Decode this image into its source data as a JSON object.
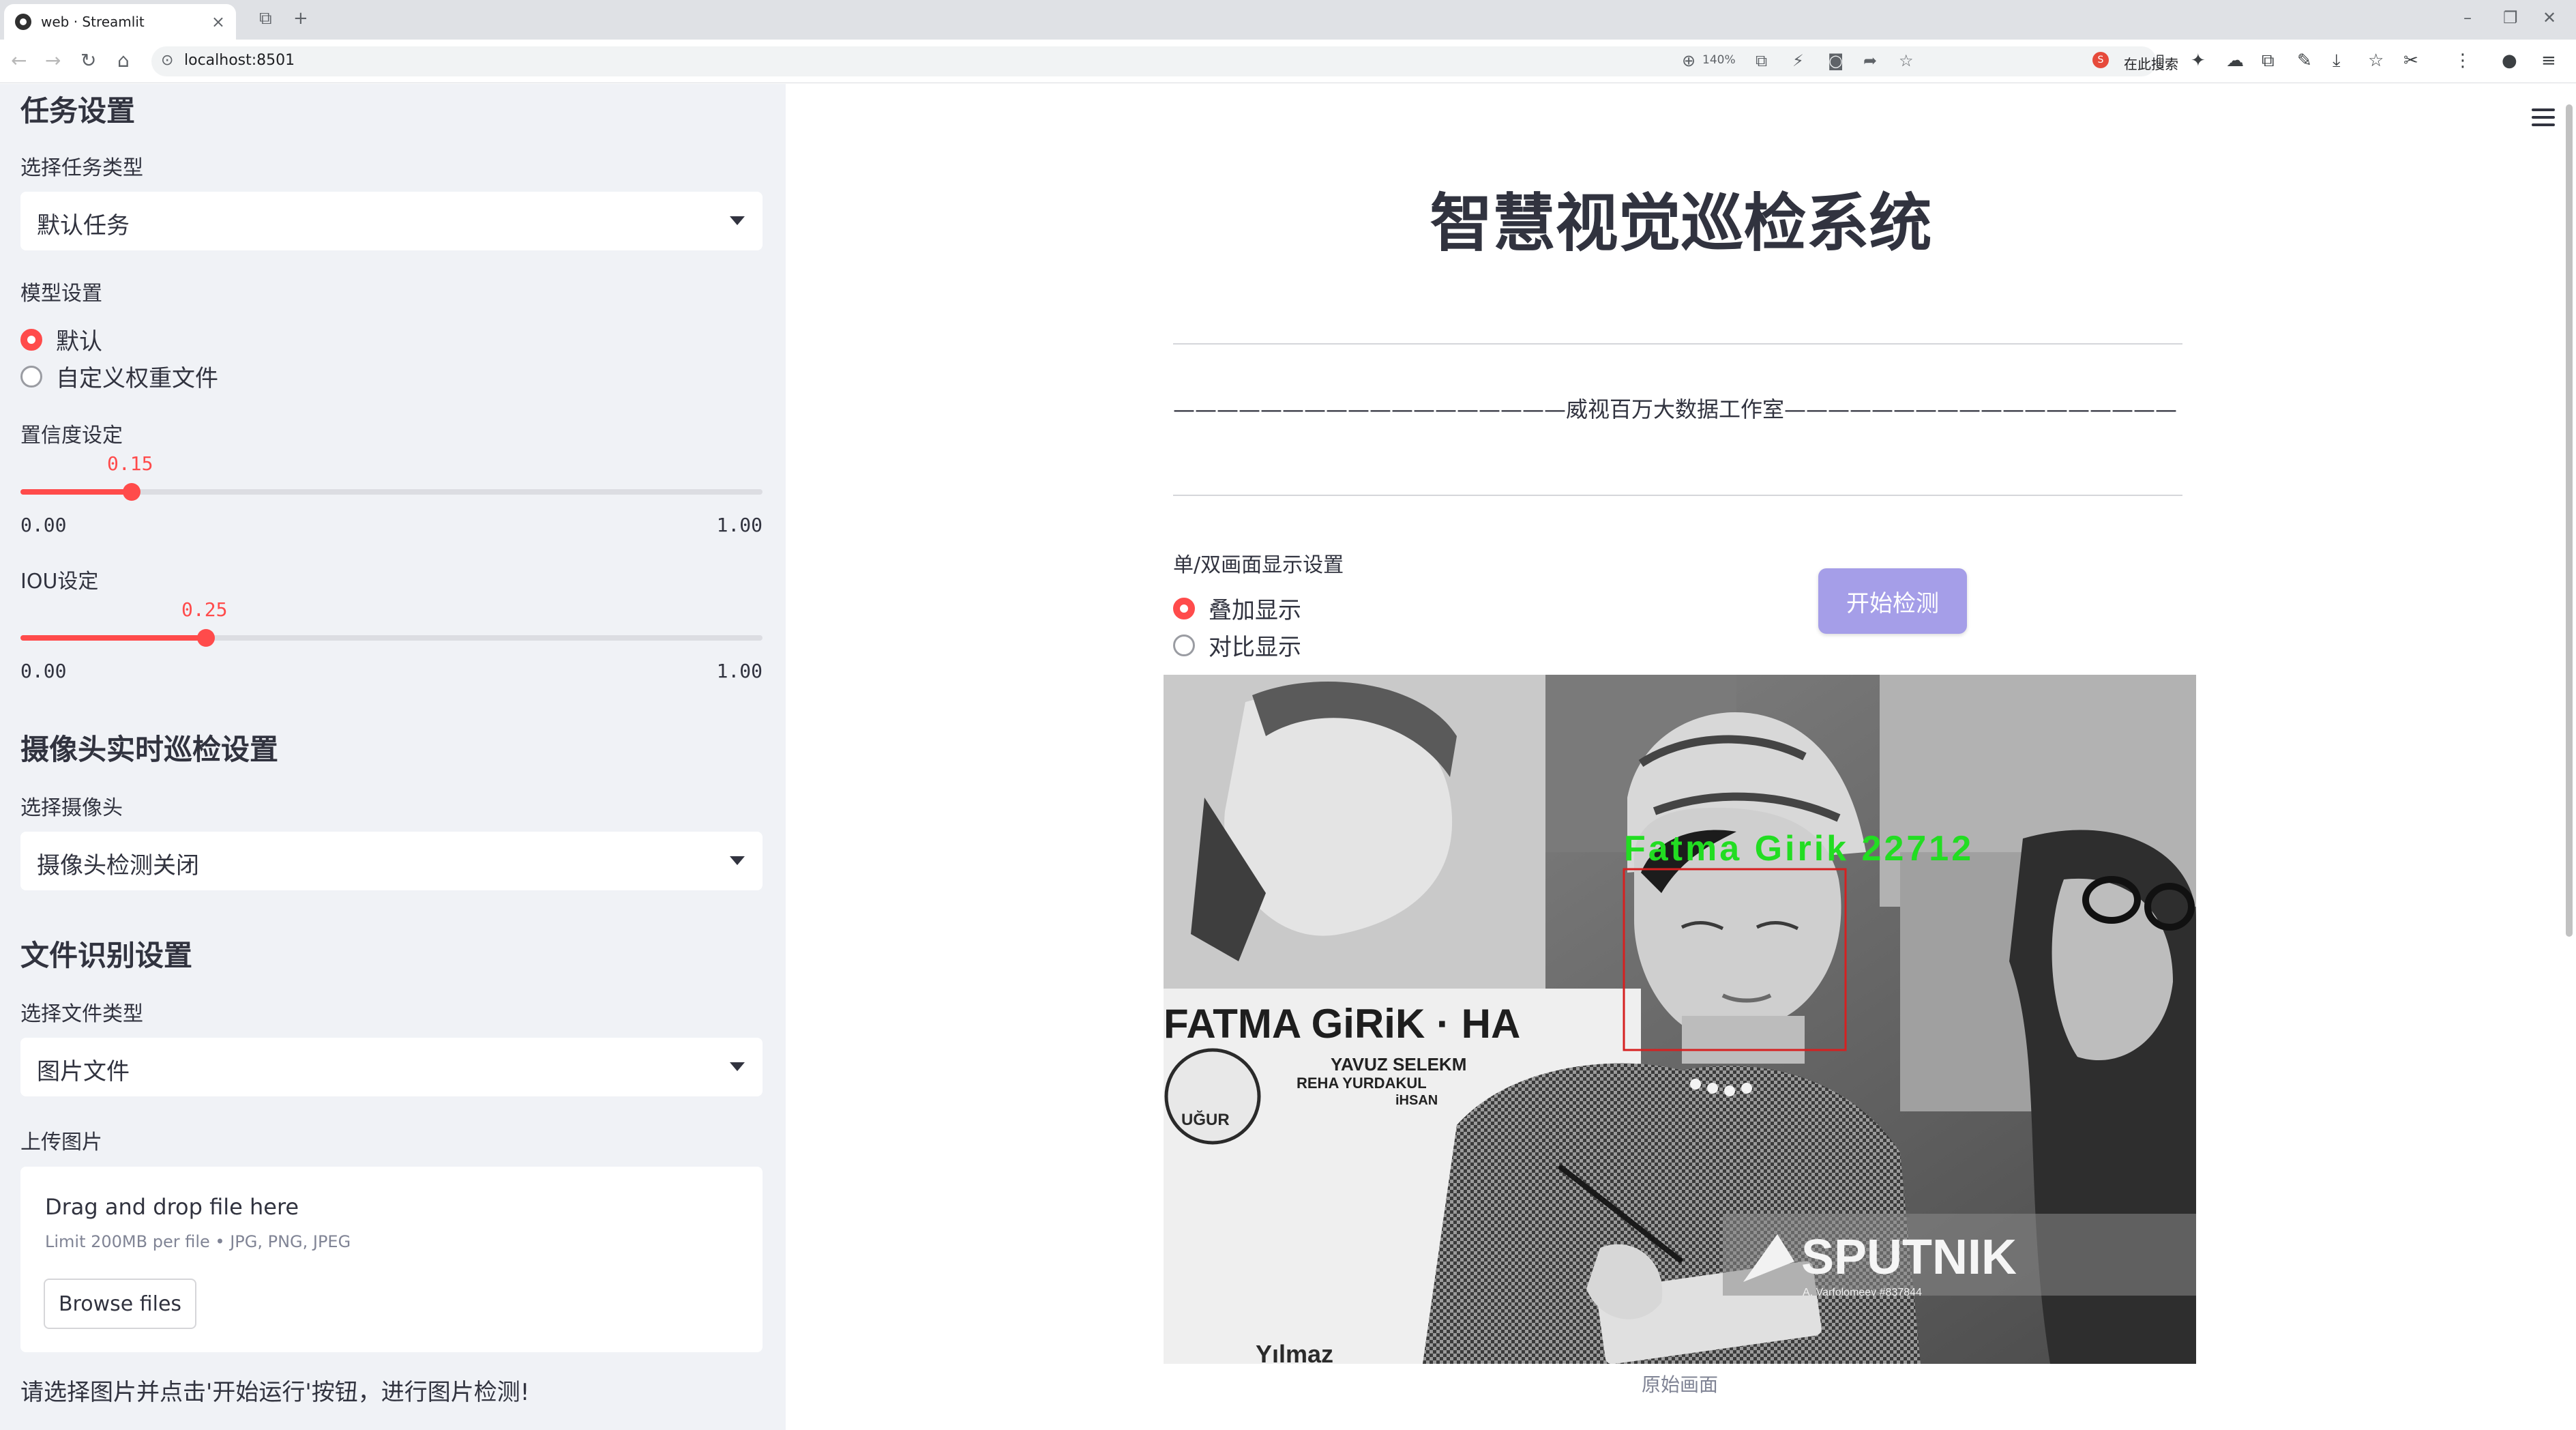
{
  "browser": {
    "tab_title": "web · Streamlit",
    "url": "localhost:8501",
    "zoom": "140%",
    "search_label": "在此搜索"
  },
  "sidebar": {
    "task_section": {
      "heading": "任务设置",
      "task_type_label": "选择任务类型",
      "task_type_value": "默认任务",
      "model_label": "模型设置",
      "model_options": [
        "默认",
        "自定义权重文件"
      ],
      "model_selected": 0,
      "confidence": {
        "label": "置信度设定",
        "value": "0.15",
        "min": "0.00",
        "max": "1.00",
        "fraction": 0.15
      },
      "iou": {
        "label": "IOU设定",
        "value": "0.25",
        "min": "0.00",
        "max": "1.00",
        "fraction": 0.25
      }
    },
    "camera_section": {
      "heading": "摄像头实时巡检设置",
      "camera_label": "选择摄像头",
      "camera_value": "摄像头检测关闭"
    },
    "file_section": {
      "heading": "文件识别设置",
      "file_type_label": "选择文件类型",
      "file_type_value": "图片文件",
      "upload_label": "上传图片",
      "dropzone_title": "Drag and drop file here",
      "dropzone_limit": "Limit 200MB per file • JPG, PNG, JPEG",
      "browse_label": "Browse files"
    },
    "hint": "请选择图片并点击'开始运行'按钮，进行图片检测!"
  },
  "main": {
    "title": "智慧视觉巡检系统",
    "studio_line": "——————————————————威视百万大数据工作室——————————————————",
    "display_label": "单/双画面显示设置",
    "display_options": [
      "叠加显示",
      "对比显示"
    ],
    "display_selected": 0,
    "start_button": "开始检测",
    "detection": {
      "label": "Fatma Girik  22712",
      "box_color": "#d62020",
      "text_color": "#22dd22"
    },
    "image_texts": {
      "poster_name": "FATMA GiRiK · HA",
      "poster_credits": "YAVUZ SELEKM",
      "poster_credits2": "REHA YURDAKUL",
      "poster_credits3": "iHSAN",
      "logo": "UĞUR",
      "watermark": "SPUTNIK",
      "watermark_credit": "A. Varfolomeev #837844",
      "poster_bottom": "Yılmaz"
    },
    "caption": "原始画面"
  },
  "colors": {
    "accent": "#ff4b4b",
    "sidebar_bg": "#f0f2f6",
    "button_bg": "#a59ee8"
  }
}
